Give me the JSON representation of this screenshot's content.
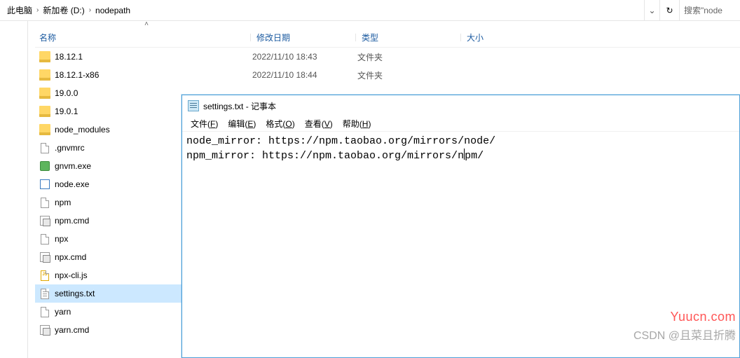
{
  "breadcrumb": {
    "items": [
      "此电脑",
      "新加卷 (D:)",
      "nodepath"
    ]
  },
  "search": {
    "placeholder": "搜索\"node"
  },
  "headers": {
    "name": "名称",
    "date": "修改日期",
    "type": "类型",
    "size": "大小"
  },
  "files": [
    {
      "icon": "folder",
      "name": "18.12.1",
      "date": "2022/11/10 18:43",
      "type": "文件夹",
      "selected": false
    },
    {
      "icon": "folder",
      "name": "18.12.1-x86",
      "date": "2022/11/10 18:44",
      "type": "文件夹",
      "selected": false
    },
    {
      "icon": "folder",
      "name": "19.0.0",
      "date": "",
      "type": "",
      "selected": false
    },
    {
      "icon": "folder",
      "name": "19.0.1",
      "date": "",
      "type": "",
      "selected": false
    },
    {
      "icon": "folder",
      "name": "node_modules",
      "date": "",
      "type": "",
      "selected": false
    },
    {
      "icon": "file",
      "name": ".gnvmrc",
      "date": "",
      "type": "",
      "selected": false
    },
    {
      "icon": "gnvm",
      "name": "gnvm.exe",
      "date": "",
      "type": "",
      "selected": false
    },
    {
      "icon": "exe",
      "name": "node.exe",
      "date": "",
      "type": "",
      "selected": false
    },
    {
      "icon": "file",
      "name": "npm",
      "date": "",
      "type": "",
      "selected": false
    },
    {
      "icon": "cmd",
      "name": "npm.cmd",
      "date": "",
      "type": "",
      "selected": false
    },
    {
      "icon": "file",
      "name": "npx",
      "date": "",
      "type": "",
      "selected": false
    },
    {
      "icon": "cmd",
      "name": "npx.cmd",
      "date": "",
      "type": "",
      "selected": false
    },
    {
      "icon": "js",
      "name": "npx-cli.js",
      "date": "",
      "type": "",
      "selected": false
    },
    {
      "icon": "txt",
      "name": "settings.txt",
      "date": "",
      "type": "",
      "selected": true
    },
    {
      "icon": "file",
      "name": "yarn",
      "date": "",
      "type": "",
      "selected": false
    },
    {
      "icon": "cmd",
      "name": "yarn.cmd",
      "date": "",
      "type": "",
      "selected": false
    }
  ],
  "notepad": {
    "title": "settings.txt - 记事本",
    "menu": {
      "file": {
        "label": "文件",
        "hotkey": "F"
      },
      "edit": {
        "label": "编辑",
        "hotkey": "E"
      },
      "format": {
        "label": "格式",
        "hotkey": "O"
      },
      "view": {
        "label": "查看",
        "hotkey": "V"
      },
      "help": {
        "label": "帮助",
        "hotkey": "H"
      }
    },
    "line1": "node_mirror: https://npm.taobao.org/mirrors/node/",
    "line2a": "npm_mirror: https://npm.taobao.org/mirrors/n",
    "line2b": "pm/"
  },
  "watermark1": "Yuucn.com",
  "watermark2": "CSDN @且菜且折腾"
}
